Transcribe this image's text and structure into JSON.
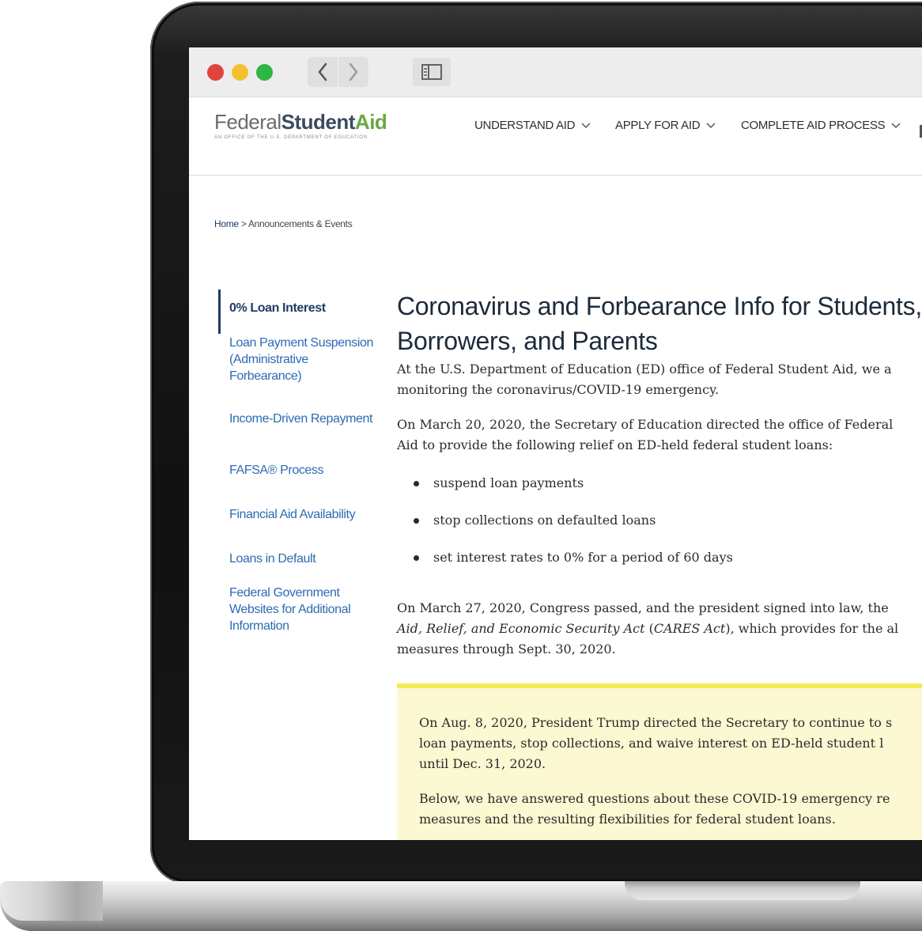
{
  "site": {
    "logo_federal": "Federal",
    "logo_student": "Student",
    "logo_aid": "Aid",
    "logo_tagline": "An OFFICE of the U.S. DEPARTMENT of EDUCATION"
  },
  "mainnav": {
    "items": [
      {
        "label": "UNDERSTAND AID"
      },
      {
        "label": "APPLY FOR AID"
      },
      {
        "label": "COMPLETE AID PROCESS"
      }
    ]
  },
  "breadcrumb": {
    "home": "Home",
    "separator": " > ",
    "current": "Announcements & Events"
  },
  "sidenav": {
    "items": [
      {
        "label": "0% Loan Interest",
        "active": true
      },
      {
        "label": "Loan Payment Suspension (Administrative Forbearance)"
      },
      {
        "label": "Income-Driven Repayment"
      },
      {
        "label": "FAFSA® Process"
      },
      {
        "label": "Financial Aid Availability"
      },
      {
        "label": "Loans in Default"
      },
      {
        "label": "Federal Government Websites for Additional Information"
      }
    ]
  },
  "article": {
    "title_line1": "Coronavirus and Forbearance Info for Students,",
    "title_line2": "Borrowers, and Parents",
    "intro_line1": "At the U.S. Department of Education (ED) office of Federal Student Aid, we a",
    "intro_line2": "monitoring the coronavirus/COVID-19 emergency.",
    "march20_line1": "On March 20, 2020, the Secretary of Education directed the office of Federal",
    "march20_line2": "Aid to provide the following relief on ED-held federal student loans:",
    "bullets": [
      "suspend loan payments",
      "stop collections on defaulted loans",
      "set interest rates to 0% for a period of 60 days"
    ],
    "march27_line1": "On March 27, 2020, Congress passed, and the president signed into law, the",
    "march27_line2_italic": "Aid, Relief, and Economic Security Act",
    "march27_line2_paren_open": " (",
    "march27_line2_cares": "CARES Act",
    "march27_line2_rest": "), which provides for the al",
    "march27_line3": "measures through Sept. 30, 2020."
  },
  "notice": {
    "aug_line1": "On Aug. 8, 2020, President Trump directed the Secretary to continue to s",
    "aug_line2": "loan payments, stop collections, and waive interest on ED-held student l",
    "aug_line3": "until Dec. 31, 2020.",
    "below_line1": "Below, we have answered questions about these COVID-19 emergency re",
    "below_line2": "measures and the resulting flexibilities for federal student loans.",
    "background_color": "#fbf8d2",
    "border_color": "#f3ea58"
  },
  "colors": {
    "link_blue": "#2d6ab4",
    "navy": "#1f3c63",
    "logo_green": "#6aa842"
  },
  "icons": {
    "window_buttons": [
      "close-dot",
      "minimize-dot",
      "zoom-dot"
    ],
    "back": "chevron-left-icon",
    "forward": "chevron-right-icon",
    "sidebar": "sidebar-toggle-icon",
    "nav_dropdown": "chevron-down-icon"
  }
}
